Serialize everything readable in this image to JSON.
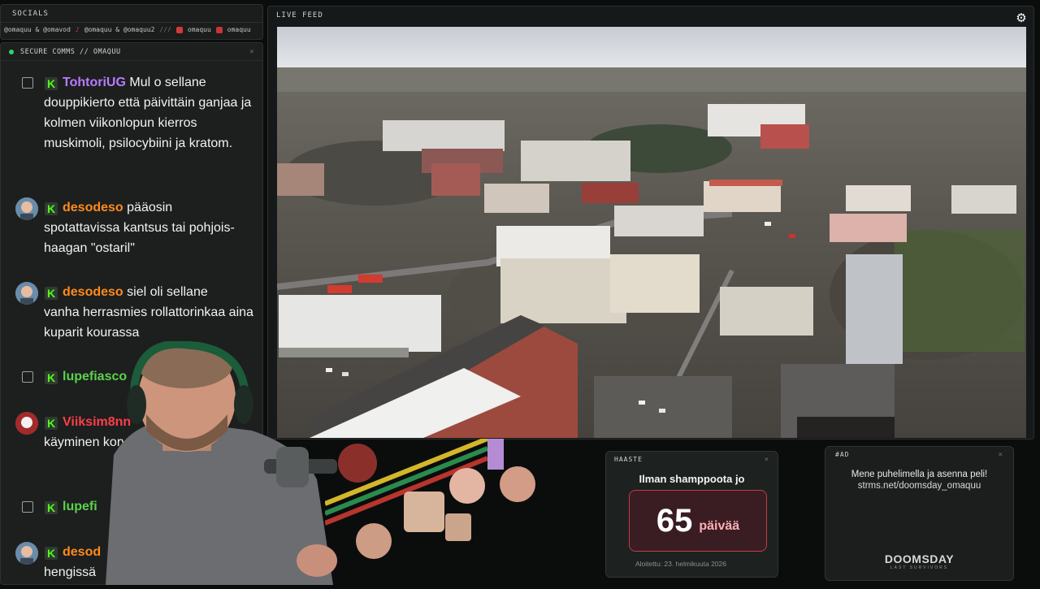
{
  "socials": {
    "header": "SOCIALS",
    "handles": [
      "@omaquu & @omavod",
      "@omaquu & @omaquu2",
      "///",
      "omaquu",
      "omaquu"
    ]
  },
  "comms": {
    "header": "SECURE COMMS // OMAQUU",
    "messages": [
      {
        "user": "TohtoriUG",
        "first": "Mul o sellane",
        "rest": "douppikierto että päivittäin ganjaa ja kolmen viikonlopun kierros muskimoli, psilocybiini ja kratom."
      },
      {
        "user": "desodeso",
        "first": "pääosin",
        "rest": "spotattavissa kantsus tai pohjois-haagan \"ostaril\""
      },
      {
        "user": "desodeso",
        "first": "siel oli sellane",
        "rest": "vanha herrasmies rollattorinkaa aina kuparit kourassa"
      },
      {
        "user": "lupefiasco",
        "first": "",
        "rest": ""
      },
      {
        "user": "Viiksim8nn",
        "first": "",
        "rest": "käyminen korvaa l... käymisen"
      },
      {
        "user": "lupefi",
        "first": "",
        "rest": ""
      },
      {
        "user": "desod",
        "first": "",
        "rest": "hengissä"
      }
    ]
  },
  "livefeed": {
    "header": "LIVE FEED"
  },
  "haaste": {
    "header": "HAASTE",
    "title": "Ilman shamppoota jo",
    "count": "65",
    "unit": "päivää",
    "footer": "Aloitettu: 23. helmikuuta 2026"
  },
  "ad": {
    "header": "#AD",
    "line1": "Mene puhelimella ja asenna peli!",
    "line2": "strms.net/doomsday_omaquu",
    "logo": "DOOMSDAY",
    "sublogo": "LAST SURVIVORS"
  }
}
